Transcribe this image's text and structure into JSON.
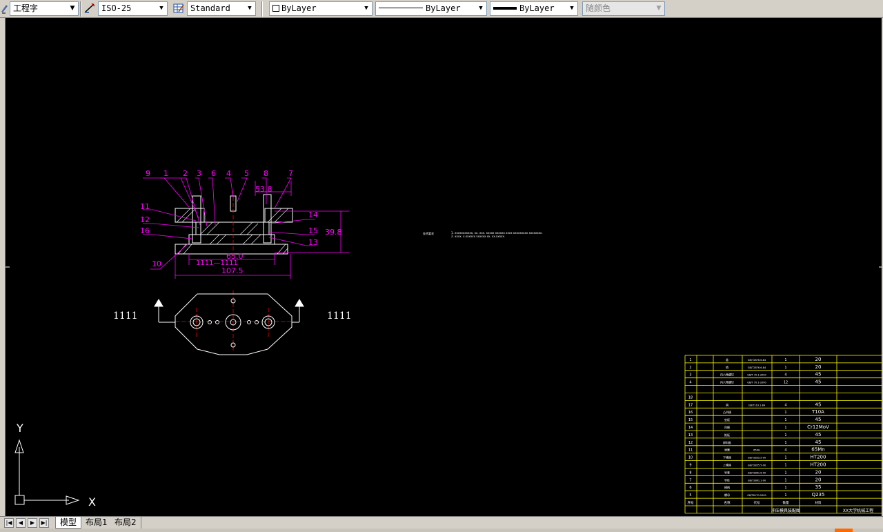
{
  "toolbar": {
    "text_style": "工程字",
    "dim_style": "ISO-25",
    "table_style": "Standard",
    "layer_color_label": "ByLayer",
    "linetype_label": "ByLayer",
    "lineweight_label": "ByLayer",
    "plot_style": "随颜色"
  },
  "drawing": {
    "balloon_labels": [
      "9",
      "1",
      "2",
      "3",
      "6",
      "4",
      "5",
      "8",
      "7",
      "11",
      "12",
      "16",
      "14",
      "15",
      "13",
      "10"
    ],
    "dimensions": {
      "top_width": "53.8",
      "height": "39.8",
      "inner_width": "65.0",
      "overall_width": "107.5"
    },
    "section_marks": {
      "left": "1111",
      "right": "1111",
      "center": "1111—1111"
    },
    "tech_requirements_title": "技术要求",
    "tech_requirements_lines": [
      "1. xxxxxxxxxxx, xx. xxx. xxxxx xxxxxx xxxx xxxxxxxxx xxxxxxxx.",
      "2. xxxx. x.xxxxxx xxxxxx.xx. xx.xxxxx."
    ]
  },
  "parts_table": {
    "rows": [
      {
        "no": "1",
        "name": "盖",
        "std": "GB/T2876.6-84",
        "qty": "1",
        "mat": "20"
      },
      {
        "no": "2",
        "name": "销",
        "std": "GB/T2876.6-84",
        "qty": "1",
        "mat": "20"
      },
      {
        "no": "3",
        "name": "内六角螺钉",
        "std": "GB/T 70.1-2000",
        "qty": "4",
        "mat": "45"
      },
      {
        "no": "4",
        "name": "内六角螺钉",
        "std": "GB/T 70.1-2000",
        "qty": "12",
        "mat": "45"
      },
      {
        "no": "",
        "name": "",
        "std": "",
        "qty": "",
        "mat": ""
      },
      {
        "no": "18",
        "name": "",
        "std": "",
        "qty": "",
        "mat": ""
      },
      {
        "no": "17",
        "name": "销",
        "std": "GB/T119.1-84",
        "qty": "4",
        "mat": "45"
      },
      {
        "no": "16",
        "name": "凸凹模",
        "std": "",
        "qty": "1",
        "mat": "T10A"
      },
      {
        "no": "15",
        "name": "垫板",
        "std": "",
        "qty": "1",
        "mat": "45"
      },
      {
        "no": "14",
        "name": "凹模",
        "std": "",
        "qty": "1",
        "mat": "Cr12MoV"
      },
      {
        "no": "13",
        "name": "推板",
        "std": "",
        "qty": "1",
        "mat": "45"
      },
      {
        "no": "12",
        "name": "卸料板",
        "std": "",
        "qty": "1",
        "mat": "45"
      },
      {
        "no": "11",
        "name": "弹簧",
        "std": "65Mn",
        "qty": "4",
        "mat": "65Mn"
      },
      {
        "no": "10",
        "name": "下模座",
        "std": "GB/T2855.5-90",
        "qty": "1",
        "mat": "HT200"
      },
      {
        "no": "9",
        "name": "上模座",
        "std": "GB/T2855.5-90",
        "qty": "1",
        "mat": "HT200"
      },
      {
        "no": "8",
        "name": "导套",
        "std": "GB/T2861.6-90",
        "qty": "1",
        "mat": "20"
      },
      {
        "no": "7",
        "name": "导柱",
        "std": "GB/T2861.1-90",
        "qty": "1",
        "mat": "20"
      },
      {
        "no": "6",
        "name": "模柄",
        "std": "",
        "qty": "1",
        "mat": "35"
      },
      {
        "no": "5",
        "name": "螺母",
        "std": "GB/T6170-2000",
        "qty": "1",
        "mat": "Q235"
      }
    ],
    "header": {
      "no": "序号",
      "name": "名称",
      "std": "代号",
      "qty": "数量",
      "mat": "材料"
    },
    "footer_left": "冲压模具装配图",
    "footer_right": "XX大学机械工程"
  },
  "ucs": {
    "x_label": "X",
    "y_label": "Y"
  },
  "tabs": {
    "model": "模型",
    "layout1": "布局1",
    "layout2": "布局2"
  },
  "colors": {
    "canvas": "#000000",
    "magenta": "#ff00ff",
    "yellow": "#ffff00",
    "red": "#ff0000",
    "white": "#ffffff"
  }
}
